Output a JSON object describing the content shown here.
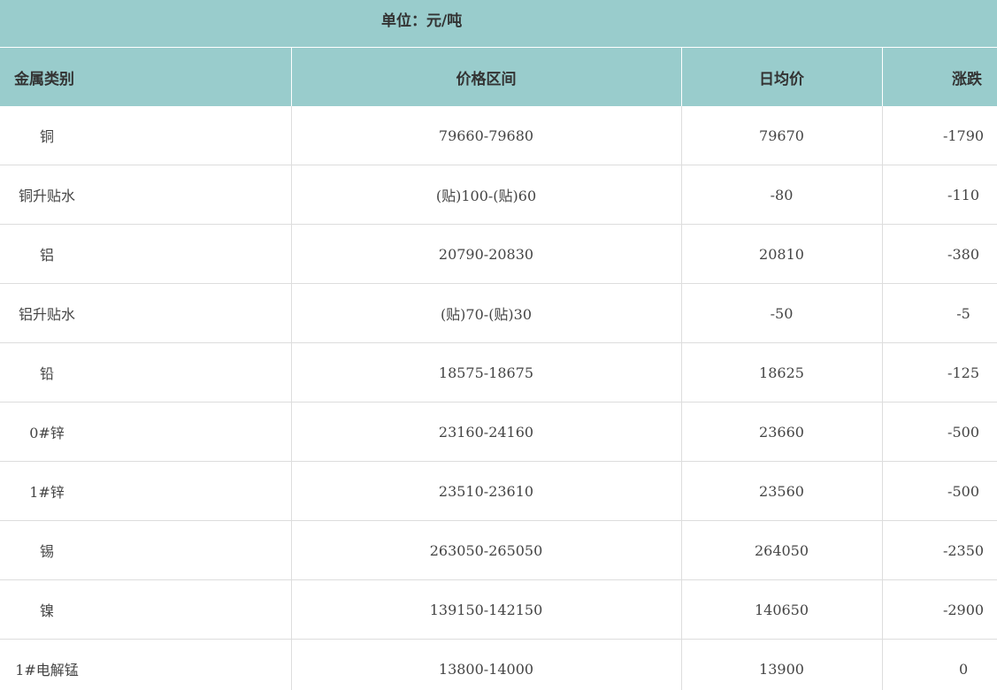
{
  "unit_label": "单位：元/吨",
  "header": {
    "category": "金属类别",
    "range": "价格区间",
    "average": "日均价",
    "change": "涨跌"
  },
  "rows": [
    {
      "category": "铜",
      "range": "79660-79680",
      "average": "79670",
      "change": "-1790"
    },
    {
      "category": "铜升贴水",
      "range": "(贴)100-(贴)60",
      "average": "-80",
      "change": "-110"
    },
    {
      "category": "铝",
      "range": "20790-20830",
      "average": "20810",
      "change": "-380"
    },
    {
      "category": "铝升贴水",
      "range": "(贴)70-(贴)30",
      "average": "-50",
      "change": "-5"
    },
    {
      "category": "铅",
      "range": "18575-18675",
      "average": "18625",
      "change": "-125"
    },
    {
      "category": "0#锌",
      "range": "23160-24160",
      "average": "23660",
      "change": "-500"
    },
    {
      "category": "1#锌",
      "range": "23510-23610",
      "average": "23560",
      "change": "-500"
    },
    {
      "category": "锡",
      "range": "263050-265050",
      "average": "264050",
      "change": "-2350"
    },
    {
      "category": "镍",
      "range": "139150-142150",
      "average": "140650",
      "change": "-2900"
    },
    {
      "category": "1#电解锰",
      "range": "13800-14000",
      "average": "13900",
      "change": "0"
    }
  ],
  "colors": {
    "header_bg": "#99cccc",
    "border": "#dddddd",
    "text": "#444444"
  }
}
